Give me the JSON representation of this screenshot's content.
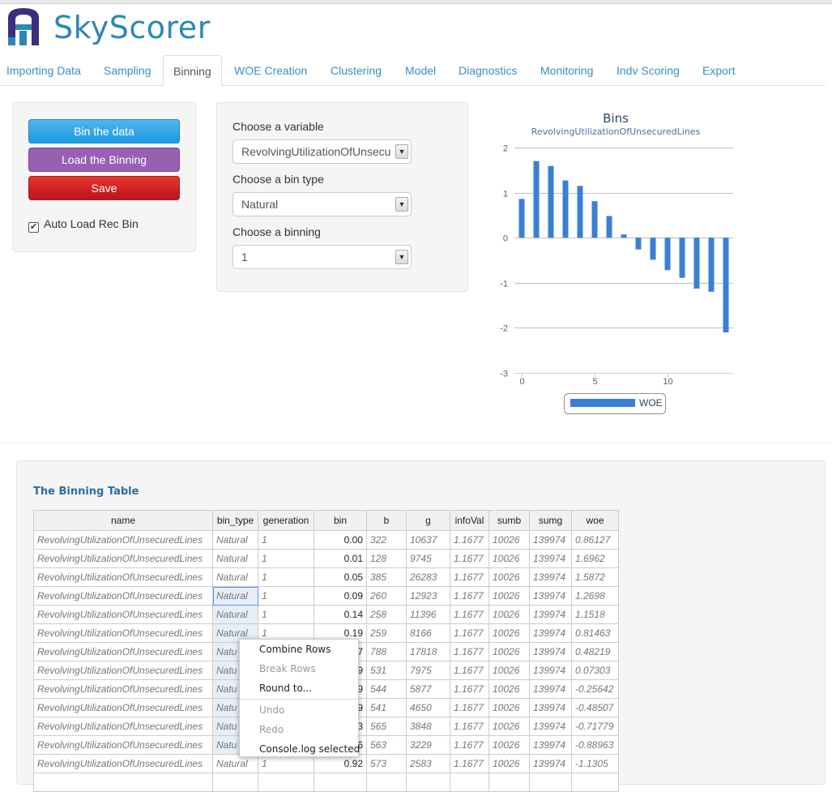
{
  "app": {
    "brand": "SkyScorer"
  },
  "tabs": [
    {
      "label": "Importing Data"
    },
    {
      "label": "Sampling"
    },
    {
      "label": "Binning"
    },
    {
      "label": "WOE Creation"
    },
    {
      "label": "Clustering"
    },
    {
      "label": "Model"
    },
    {
      "label": "Diagnostics"
    },
    {
      "label": "Monitoring"
    },
    {
      "label": "Indv Scoring"
    },
    {
      "label": "Export"
    }
  ],
  "active_tab": "Binning",
  "actions": {
    "bin_label": "Bin the data",
    "load_label": "Load the Binning",
    "save_label": "Save",
    "auto_load_label": "Auto Load Rec Bin",
    "auto_load_checked": true
  },
  "controls": {
    "variable_label": "Choose a variable",
    "variable_value": "RevolvingUtilizationOfUnsecu",
    "bintype_label": "Choose a bin type",
    "bintype_value": "Natural",
    "binning_label": "Choose a binning",
    "binning_value": "1"
  },
  "chart_data": {
    "type": "bar",
    "title": "Bins",
    "subtitle": "RevolvingUtilizationOfUnsecuredLines",
    "series": [
      {
        "name": "WOE",
        "x": [
          0,
          1,
          2,
          3,
          4,
          5,
          6,
          7,
          8,
          9,
          10,
          11,
          12,
          13,
          14
        ],
        "values": [
          0.86,
          1.7,
          1.59,
          1.27,
          1.15,
          0.81,
          0.48,
          0.07,
          -0.26,
          -0.49,
          -0.72,
          -0.89,
          -1.13,
          -1.2,
          -2.1
        ]
      }
    ],
    "x_ticks": [
      0,
      5,
      10
    ],
    "y_ticks": [
      2,
      1,
      0,
      -1,
      -2,
      -3
    ],
    "ylim": [
      -3,
      2
    ],
    "xlim": [
      -0.5,
      14.5
    ],
    "grid": true,
    "legend_position": "bottom",
    "color": "#3a7fd5"
  },
  "table": {
    "title": "The Binning Table",
    "columns": [
      "name",
      "bin_type",
      "generation",
      "bin",
      "b",
      "g",
      "infoVal",
      "sumb",
      "sumg",
      "woe"
    ],
    "rows": [
      [
        "RevolvingUtilizationOfUnsecuredLines",
        "Natural",
        "1",
        "0.00",
        "322",
        "10637",
        "1.1677",
        "10026",
        "139974",
        "0.86127"
      ],
      [
        "RevolvingUtilizationOfUnsecuredLines",
        "Natural",
        "1",
        "0.01",
        "128",
        "9745",
        "1.1677",
        "10026",
        "139974",
        "1.6962"
      ],
      [
        "RevolvingUtilizationOfUnsecuredLines",
        "Natural",
        "1",
        "0.05",
        "385",
        "26283",
        "1.1677",
        "10026",
        "139974",
        "1.5872"
      ],
      [
        "RevolvingUtilizationOfUnsecuredLines",
        "Natural",
        "1",
        "0.09",
        "260",
        "12923",
        "1.1677",
        "10026",
        "139974",
        "1.2698"
      ],
      [
        "RevolvingUtilizationOfUnsecuredLines",
        "Natural",
        "1",
        "0.14",
        "258",
        "11396",
        "1.1677",
        "10026",
        "139974",
        "1.1518"
      ],
      [
        "RevolvingUtilizationOfUnsecuredLines",
        "Natural",
        "1",
        "0.19",
        "259",
        "8166",
        "1.1677",
        "10026",
        "139974",
        "0.81463"
      ],
      [
        "RevolvingUtilizationOfUnsecuredLines",
        "Natu",
        "",
        "7",
        "788",
        "17818",
        "1.1677",
        "10026",
        "139974",
        "0.48219"
      ],
      [
        "RevolvingUtilizationOfUnsecuredLines",
        "Natu",
        "",
        "9",
        "531",
        "7975",
        "1.1677",
        "10026",
        "139974",
        "0.07303"
      ],
      [
        "RevolvingUtilizationOfUnsecuredLines",
        "Natu",
        "",
        "9",
        "544",
        "5877",
        "1.1677",
        "10026",
        "139974",
        "-0.25642"
      ],
      [
        "RevolvingUtilizationOfUnsecuredLines",
        "Natu",
        "",
        "9",
        "541",
        "4650",
        "1.1677",
        "10026",
        "139974",
        "-0.48507"
      ],
      [
        "RevolvingUtilizationOfUnsecuredLines",
        "Natu",
        "",
        "3",
        "565",
        "3848",
        "1.1677",
        "10026",
        "139974",
        "-0.71779"
      ],
      [
        "RevolvingUtilizationOfUnsecuredLines",
        "Natu",
        "",
        "6",
        "563",
        "3229",
        "1.1677",
        "10026",
        "139974",
        "-0.88963"
      ],
      [
        "RevolvingUtilizationOfUnsecuredLines",
        "Natural",
        "1",
        "0.92",
        "573",
        "2583",
        "1.1677",
        "10026",
        "139974",
        "-1.1305"
      ],
      [
        "",
        "",
        "",
        "",
        "",
        "",
        "",
        "",
        "",
        ""
      ]
    ]
  },
  "context_menu": {
    "items": [
      {
        "label": "Combine Rows",
        "enabled": true
      },
      {
        "label": "Break Rows",
        "enabled": false
      },
      {
        "label": "Round to...",
        "enabled": true
      },
      {
        "label": "Undo",
        "enabled": false
      },
      {
        "label": "Redo",
        "enabled": false
      },
      {
        "label": "Console.log selected",
        "enabled": true
      }
    ]
  }
}
